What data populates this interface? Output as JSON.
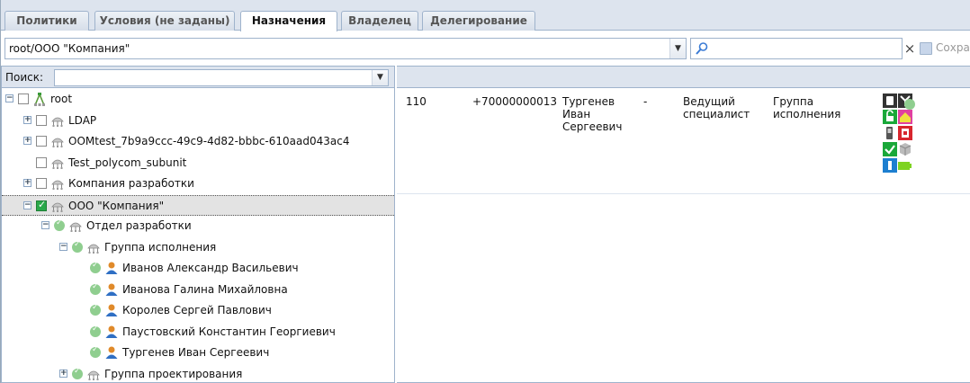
{
  "tabs": [
    {
      "label": "Политики",
      "active": false
    },
    {
      "label": "Условия (не заданы)",
      "active": false
    },
    {
      "label": "Назначения",
      "active": true
    },
    {
      "label": "Владелец",
      "active": false
    },
    {
      "label": "Делегирование",
      "active": false
    }
  ],
  "path": {
    "value": "root/ООО \"Компания\""
  },
  "search": {
    "value": "",
    "clear": "×"
  },
  "toolbar": {
    "save_label": "Сохранить"
  },
  "tree_search": {
    "label": "Поиск:",
    "value": ""
  },
  "tree": [
    {
      "label": "root",
      "icon": "root-org-icon",
      "expander": "minus",
      "check": "empty"
    },
    {
      "label": "LDAP",
      "icon": "org-unit-icon",
      "expander": "plus",
      "check": "empty"
    },
    {
      "label": "OOMtest_7b9a9ccc-49c9-4d82-bbbc-610aad043ac4",
      "icon": "org-unit-icon",
      "expander": "plus",
      "check": "empty"
    },
    {
      "label": "Test_polycom_subunit",
      "icon": "org-unit-icon",
      "expander": "none",
      "check": "empty"
    },
    {
      "label": "Компания разработки",
      "icon": "org-unit-icon",
      "expander": "plus",
      "check": "empty"
    },
    {
      "label": "ООО \"Компания\"",
      "icon": "org-unit-icon",
      "expander": "minus",
      "check": "checked",
      "selected": true
    },
    {
      "label": "Отдел разработки",
      "icon": "org-unit-icon",
      "expander": "minus",
      "check": "inherited"
    },
    {
      "label": "Группа исполнения",
      "icon": "org-unit-icon",
      "expander": "minus",
      "check": "inherited"
    },
    {
      "label": "Иванов Александр Васильевич",
      "icon": "user-icon",
      "expander": "none",
      "check": "inherited"
    },
    {
      "label": "Иванова Галина Михайловна",
      "icon": "user-icon",
      "expander": "none",
      "check": "inherited"
    },
    {
      "label": "Королев Сергей Павлович",
      "icon": "user-icon",
      "expander": "none",
      "check": "inherited"
    },
    {
      "label": "Паустовский Константин Георгиевич",
      "icon": "user-icon",
      "expander": "none",
      "check": "inherited"
    },
    {
      "label": "Тургенев Иван Сергеевич",
      "icon": "user-icon",
      "expander": "none",
      "check": "inherited"
    },
    {
      "label": "Группа проектирования",
      "icon": "org-unit-icon",
      "expander": "plus",
      "check": "inherited"
    }
  ],
  "assignments": [
    {
      "ext": "110",
      "phone": "+70000000013",
      "name": [
        "Тургенев",
        "Иван",
        "Сергеевич"
      ],
      "dash": "-",
      "position": [
        "Ведущий",
        "специалист"
      ],
      "group": [
        "Группа",
        "исполнения"
      ],
      "device_icons": [
        "smartphone-icon",
        "antenna-icon",
        "unlock-icon",
        "home-icon",
        "mobile-phone-icon",
        "sim-card-icon",
        "check-icon",
        "box-icon",
        "bluetooth-icon",
        "battery-icon"
      ],
      "status": "active"
    }
  ]
}
